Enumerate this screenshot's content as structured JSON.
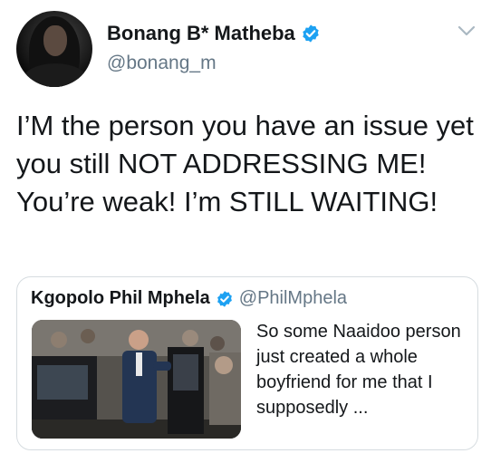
{
  "tweet": {
    "display_name": "Bonang B* Matheba",
    "handle": "@bonang_m",
    "text": "I’M the person you have an issue yet you still NOT ADDRESSING ME! You’re weak! I’m STILL WAITING!",
    "verified_color": "#1da1f2"
  },
  "quoted_tweet": {
    "display_name": "Kgopolo Phil Mphela",
    "handle": "@PhilMphela",
    "text": "So some Naaidoo person just created a whole boyfriend for me that I supposedly ..."
  },
  "icons": {
    "avatar": "profile-photo",
    "verified": "verified-badge-icon",
    "menu": "chevron-down-icon",
    "quote_media": "photo-thumbnail"
  }
}
